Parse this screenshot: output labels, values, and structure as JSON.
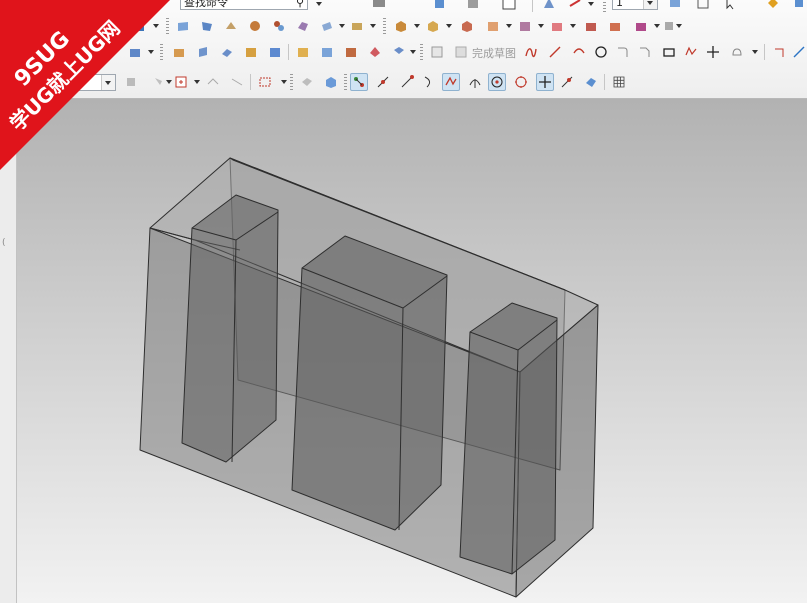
{
  "toolbar": {
    "command_finder_placeholder": "查找命令",
    "layer_combo_value": "1",
    "filter_combo_value": "",
    "finish_sketch_label": "完成草图"
  },
  "icons": {
    "row1": [
      "snap-view-icon",
      "view-style-icon",
      "wire-block-icon",
      "box-icon",
      "rect-icon",
      "revolve-icon",
      "mirror-icon",
      "grid-icon",
      "layer-icon",
      "arrow-icon",
      "diamond-icon"
    ],
    "row2": [
      "fit-view-icon",
      "box-orange-icon",
      "box-blue-icon",
      "gear-shape-icon",
      "cube-red-icon",
      "box-pink-icon",
      "cube-face-icon",
      "cube-cut-icon",
      "shaded-icon",
      "shaded-edge-icon"
    ],
    "row3": [
      "pattern-icon",
      "extrude-icon",
      "shell-icon",
      "blend-icon",
      "chamfer-icon",
      "draft-icon",
      "finish-sketch-icon",
      "line-icon",
      "arc-icon",
      "circle-icon",
      "fillet-icon",
      "chamfer-curve-icon",
      "rectangle-icon",
      "polygon-icon",
      "point-icon",
      "offset-icon"
    ],
    "row4": [
      "general-selection-icon",
      "snap-endpoint-icon",
      "snap-midpoint-icon",
      "snap-curve-icon",
      "snap-intersection-icon",
      "snap-center-icon",
      "snap-quadrant-icon",
      "snap-point-icon",
      "snap-on-curve-icon",
      "snap-face-icon",
      "snap-grid-icon"
    ]
  },
  "watermark": {
    "line1": "9SUG",
    "line2": "学UG就上UG网",
    "color": "#e0141b"
  },
  "colors": {
    "accent": "#cfe3f3",
    "model_fill": "#7a7a7a",
    "model_edge": "#2e2e2e"
  }
}
